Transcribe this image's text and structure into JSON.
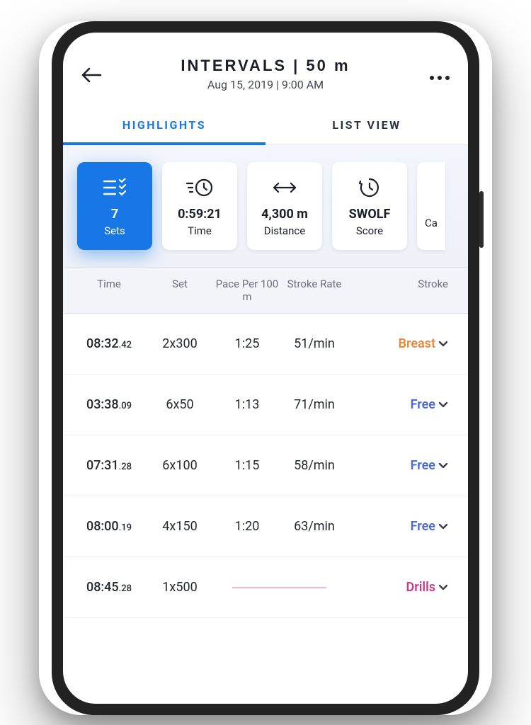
{
  "header": {
    "title": "INTERVALS | 50 m",
    "subtitle": "Aug 15, 2019 | 9:00 AM"
  },
  "tabs": {
    "highlights": "HIGHLIGHTS",
    "list_view": "LIST VIEW"
  },
  "cards": {
    "sets": {
      "value": "7",
      "label": "Sets"
    },
    "time": {
      "value": "0:59:21",
      "label": "Time"
    },
    "distance": {
      "value": "4,300 m",
      "label": "Distance"
    },
    "swolf": {
      "value": "SWOLF",
      "label": "Score"
    },
    "calories": {
      "value": "",
      "label": "Ca"
    }
  },
  "columns": {
    "time": "Time",
    "set": "Set",
    "pace": "Pace Per 100 m",
    "rate": "Stroke Rate",
    "stroke": "Stroke"
  },
  "rows": [
    {
      "time_main": "08:32",
      "time_ms": ".42",
      "set": "2x300",
      "pace": "1:25",
      "rate": "51/min",
      "stroke": "Breast",
      "stroke_class": "breast"
    },
    {
      "time_main": "03:38",
      "time_ms": ".09",
      "set": "6x50",
      "pace": "1:13",
      "rate": "71/min",
      "stroke": "Free",
      "stroke_class": "free"
    },
    {
      "time_main": "07:31",
      "time_ms": ".28",
      "set": "6x100",
      "pace": "1:15",
      "rate": "58/min",
      "stroke": "Free",
      "stroke_class": "free"
    },
    {
      "time_main": "08:00",
      "time_ms": ".19",
      "set": "4x150",
      "pace": "1:20",
      "rate": "63/min",
      "stroke": "Free",
      "stroke_class": "free"
    },
    {
      "time_main": "08:45",
      "time_ms": ".28",
      "set": "1x500",
      "pace": "",
      "rate": "",
      "stroke": "Drills",
      "stroke_class": "drills",
      "dash": true
    }
  ]
}
